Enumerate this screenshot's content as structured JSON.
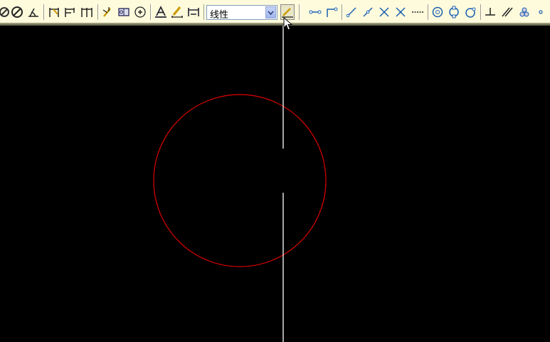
{
  "toolbar": {
    "dim_style_value": "线性",
    "buttons_left": [
      "orbit-icon",
      "no-entry-icon",
      "angle-icon",
      "dim-linear-icon",
      "dim-baseline-icon",
      "dim-continue-icon",
      "dim-edit-icon",
      "tolerance-icon",
      "center-mark-icon",
      "text-style-icon",
      "dim-edit-pencil-icon",
      "dim-update-icon"
    ],
    "buttons_right": [
      "dim-style-button",
      "snap-endpoint-icon",
      "snap-midpoint-icon",
      "snap-line-icon",
      "snap-extension-icon",
      "snap-intersection-icon",
      "snap-apparent-intersection-icon",
      "snap-dashes-icon",
      "snap-center-icon",
      "snap-quadrant-icon",
      "snap-tangent-icon",
      "snap-perpendicular-icon",
      "snap-parallel-icon",
      "snap-node-icon",
      "snap-nearest-icon"
    ]
  },
  "drawing": {
    "circle_color": "#e00000",
    "line_color": "#ffffff"
  }
}
